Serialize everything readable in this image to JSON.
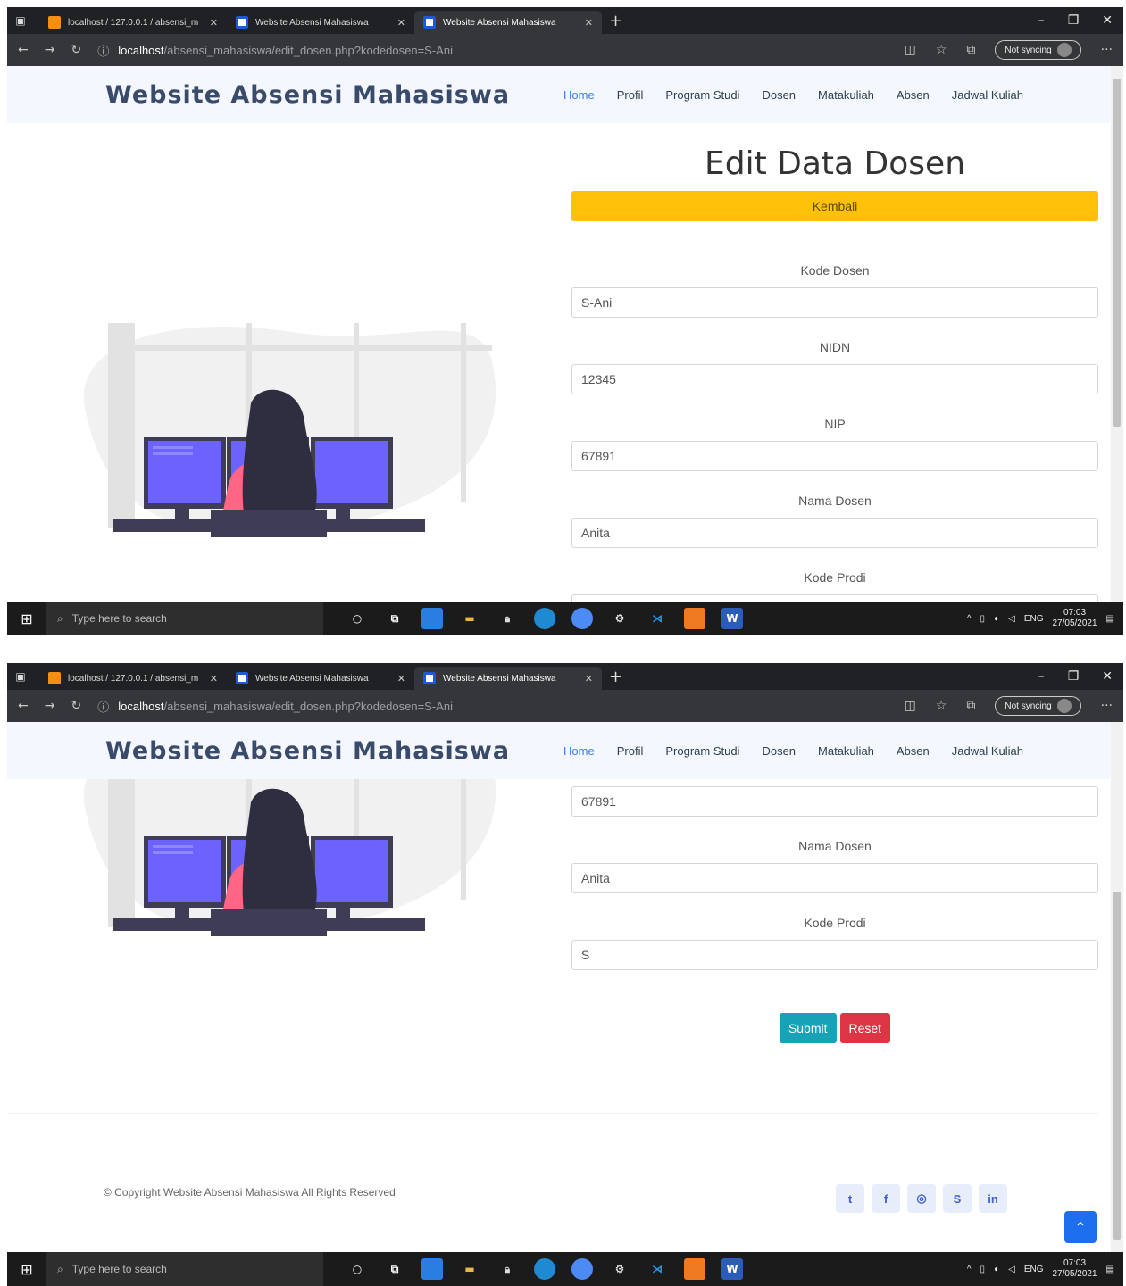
{
  "browser": {
    "tabs": [
      {
        "title": "localhost / 127.0.0.1 / absensi_m"
      },
      {
        "title": "Website Absensi Mahasiswa"
      },
      {
        "title": "Website Absensi Mahasiswa"
      }
    ],
    "url_host": "localhost",
    "url_path": "/absensi_mahasiswa/edit_dosen.php?kodedosen=S-Ani",
    "sync_label": "Not syncing"
  },
  "site": {
    "brand": "Website Absensi Mahasiswa",
    "nav": [
      "Home",
      "Profil",
      "Program Studi",
      "Dosen",
      "Matakuliah",
      "Absen",
      "Jadwal Kuliah"
    ]
  },
  "form": {
    "title": "Edit Data Dosen",
    "back_label": "Kembali",
    "fields": [
      {
        "label": "Kode Dosen",
        "value": "S-Ani"
      },
      {
        "label": "NIDN",
        "value": "12345"
      },
      {
        "label": "NIP",
        "value": "67891"
      },
      {
        "label": "Nama Dosen",
        "value": "Anita"
      },
      {
        "label": "Kode Prodi",
        "value": "S"
      }
    ],
    "submit_label": "Submit",
    "reset_label": "Reset"
  },
  "footer": {
    "copyright": "© Copyright Website Absensi Mahasiswa All Rights Reserved",
    "social": [
      "twitter-icon",
      "facebook-icon",
      "instagram-icon",
      "skype-icon",
      "linkedin-icon"
    ]
  },
  "taskbar": {
    "search_placeholder": "Type here to search",
    "lang": "ENG",
    "time": "07:03",
    "date": "27/05/2021"
  }
}
